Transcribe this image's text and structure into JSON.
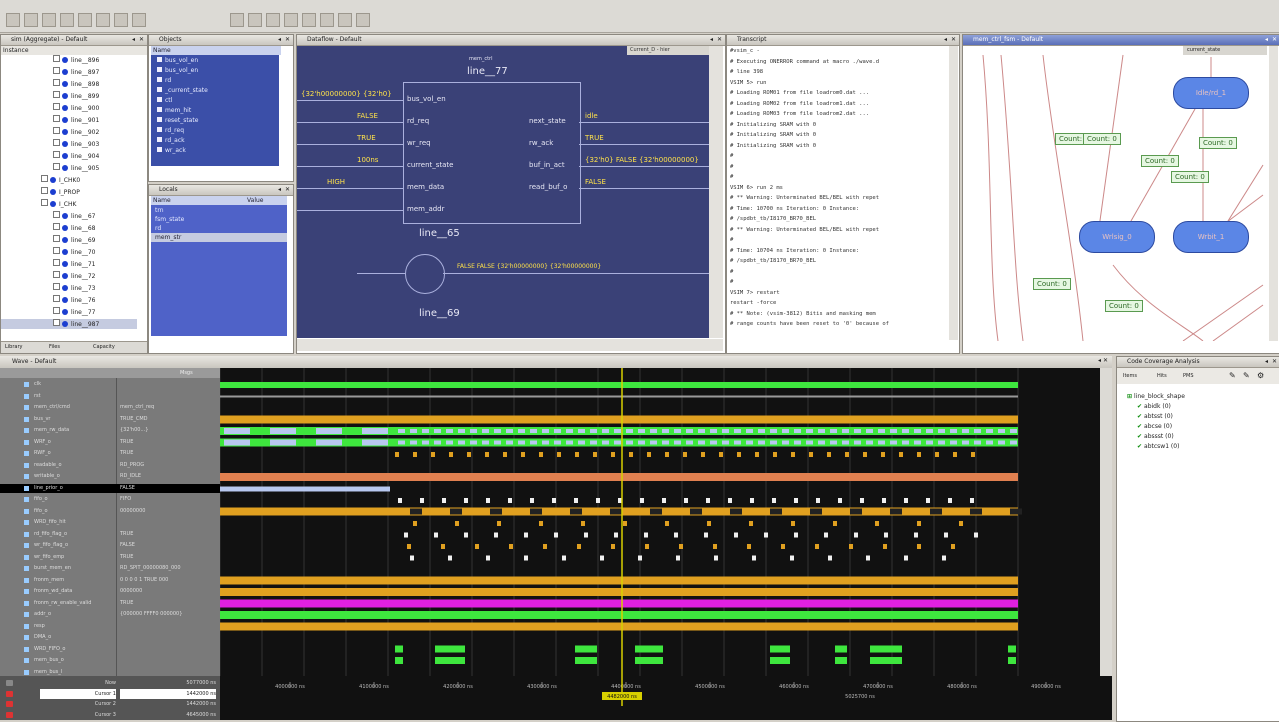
{
  "toolbar": {
    "icons": [
      "new-icon",
      "open-icon",
      "save-icon",
      "print-icon",
      "cut-icon",
      "copy-icon",
      "paste-icon",
      "undo-icon",
      "redo-icon",
      "find-icon",
      "zoom-icon",
      "run-icon",
      "step-icon",
      "stop-icon",
      "restart-icon",
      "break-icon"
    ]
  },
  "instance_pane": {
    "title": "sim (Aggregate) - Default",
    "column": "Instance",
    "items": [
      "line__896",
      "line__897",
      "line__898",
      "line__899",
      "line__900",
      "line__901",
      "line__902",
      "line__903",
      "line__904",
      "line__905",
      "I_CHK0",
      "I_PROP",
      "I_CHK",
      "line__67",
      "line__68",
      "line__69",
      "line__70",
      "line__71",
      "line__72",
      "line__73",
      "line__76",
      "line__77",
      "line__987"
    ],
    "bottom_tabs": [
      "Library",
      "Files",
      "Capacity"
    ]
  },
  "objects_pane": {
    "title": "Objects",
    "column": "Name",
    "items": [
      "bus_vol_en",
      "bus_vol_en",
      "rd",
      "_current_state",
      "ctl",
      "mem_hit",
      "reset_state",
      "rd_req",
      "rd_ack",
      "wr_ack"
    ]
  },
  "locals_pane": {
    "title": "Locals",
    "columns": [
      "Name",
      "Value"
    ],
    "items": [
      "trn",
      "fsm_state",
      "rd",
      "mem_str"
    ]
  },
  "schematic": {
    "title": "Dataflow - Default",
    "tab": "Current_D - hier",
    "block_type": "mem_ctrl",
    "block_name": "line__77",
    "inputs": [
      "bus_vol_en",
      "rd_req",
      "wr_req",
      "current_state",
      "mem_data",
      "mem_addr"
    ],
    "outputs": [
      "next_state",
      "rw_ack",
      "buf_in_act",
      "read_buf_o"
    ],
    "left_values": [
      "{32'h00000000} {32'h0}",
      "FALSE",
      "TRUE",
      "100ns",
      "HIGH"
    ],
    "right_values": [
      "idle",
      "TRUE",
      "{32'h0} FALSE {32'h00000000}",
      "FALSE"
    ],
    "lower_blocks": [
      "line__65",
      "line__69"
    ],
    "bus_value": "FALSE FALSE {32'h00000000} {32'h00000000}"
  },
  "transcript": {
    "title": "Transcript",
    "lines": [
      "#vsim_c -",
      "# Executing ONERROR command at macro ./wave.d",
      "# line 398",
      "VSIM 5> run",
      "# Loading ROM01 from file loadrom0.dat ...",
      "# Loading ROM02 from file loadrom1.dat ...",
      "# Loading ROM03 from file loadrom2.dat ...",
      "# Initializing SRAM with 0",
      "# Initializing SRAM with 0",
      "# Initializing SRAM with 0",
      "#",
      "#",
      "#",
      "VSIM 6> run 2 ms",
      "# ** Warning: Unterminated BEL/BEL with repet",
      "#   Time: 10700 ns  Iteration: 0  Instance:",
      "#   /spdbt_tb/I8170_BR70_BEL",
      "# ** Warning: Unterminated BEL/BEL with repet",
      "#",
      "#   Time: 10704 ns  Iteration: 0  Instance:",
      "#   /spdbt_tb/I8170_BR70_BEL",
      "#",
      "#",
      "VSIM 7> restart",
      "restart -force",
      "# ** Note: (vsim-3812) Bitis and masking mem",
      "# range counts have been reset to '0' because of"
    ]
  },
  "fsm": {
    "title": "mem_ctrl_fsm - Default",
    "tab": "current_state",
    "states": [
      "Idle/rd_1",
      "Wrlsig_0",
      "Wrbit_1"
    ],
    "counts": [
      "Count: 0",
      "Count: 0",
      "Count: 0",
      "Count: 0",
      "Count: 0",
      "Count: 0",
      "Count: 0"
    ]
  },
  "wave": {
    "title": "Wave - Default",
    "header": [
      "Msgs",
      ""
    ],
    "signals": [
      {
        "name": "clk",
        "value": ""
      },
      {
        "name": "rst",
        "value": ""
      },
      {
        "name": "mem_ctrl/cmd",
        "value": "mem_ctrl_req"
      },
      {
        "name": "bus_vr",
        "value": "TRUE_CMD"
      },
      {
        "name": "mem_rw_data",
        "value": "{32'h00...}"
      },
      {
        "name": "WRF_o",
        "value": "TRUE"
      },
      {
        "name": "RWF_o",
        "value": "TRUE"
      },
      {
        "name": "readable_o",
        "value": "RD_PROG"
      },
      {
        "name": "writable_o",
        "value": "RD_IDLE"
      },
      {
        "name": "line_prior_o",
        "value": "FALSE"
      },
      {
        "name": "fifo_o",
        "value": "FIFO"
      },
      {
        "name": "fifo_o",
        "value": "00000000"
      },
      {
        "name": "WRD_fifo_hit",
        "value": ""
      },
      {
        "name": "rd_fifo_flag_o",
        "value": "TRUE"
      },
      {
        "name": "wr_fifo_flag_o",
        "value": "FALSE"
      },
      {
        "name": "wr_fifo_emp",
        "value": "TRUE"
      },
      {
        "name": "burst_mem_en",
        "value": "RD_SPIT_00000080_000"
      },
      {
        "name": "fronm_mem",
        "value": "0 0 0 0 1 TRUE 000"
      },
      {
        "name": "fronm_wd_data",
        "value": "0000000"
      },
      {
        "name": "fronm_rw_enable_valid",
        "value": "TRUE"
      },
      {
        "name": "addr_o",
        "value": "{000000 FFFF0 000000}"
      },
      {
        "name": "resp",
        "value": ""
      },
      {
        "name": "DMA_o",
        "value": ""
      },
      {
        "name": "WRD_FIFO_o",
        "value": ""
      },
      {
        "name": "mem_bus_o",
        "value": ""
      },
      {
        "name": "mem_bus_l",
        "value": ""
      }
    ],
    "cursors": [
      {
        "name": "Now",
        "value": "5077000 ns"
      },
      {
        "name": "Cursor 1",
        "value": "1442000 ns"
      },
      {
        "name": "Cursor 2",
        "value": "1442000 ns"
      },
      {
        "name": "Cursor 3",
        "value": "4645000 ns"
      }
    ],
    "time_ticks": [
      "4000000 ns",
      "4100000 ns",
      "4200000 ns",
      "4300000 ns",
      "4400000 ns",
      "4500000 ns",
      "4600000 ns",
      "4700000 ns",
      "4800000 ns",
      "4900000 ns",
      "5000000 ns"
    ],
    "cursor_label": "4482000 ns",
    "cursor_label2": "5025700 ns",
    "colors": {
      "green": "#3ee63e",
      "orange": "#e0a020",
      "magenta": "#e020e0",
      "bus_blue": "#b8c8f0",
      "salmon": "#e08050",
      "cursor": "#d8d000"
    }
  },
  "coverage": {
    "title": "Code Coverage Analysis",
    "columns": [
      "Items",
      "Hits",
      "PMS"
    ],
    "items": [
      "line_block_shape",
      "abidk  (0)",
      "abtsst  (0)",
      "abcse  (0)",
      "abssst  (0)",
      "abtcsw1  (0)"
    ]
  }
}
